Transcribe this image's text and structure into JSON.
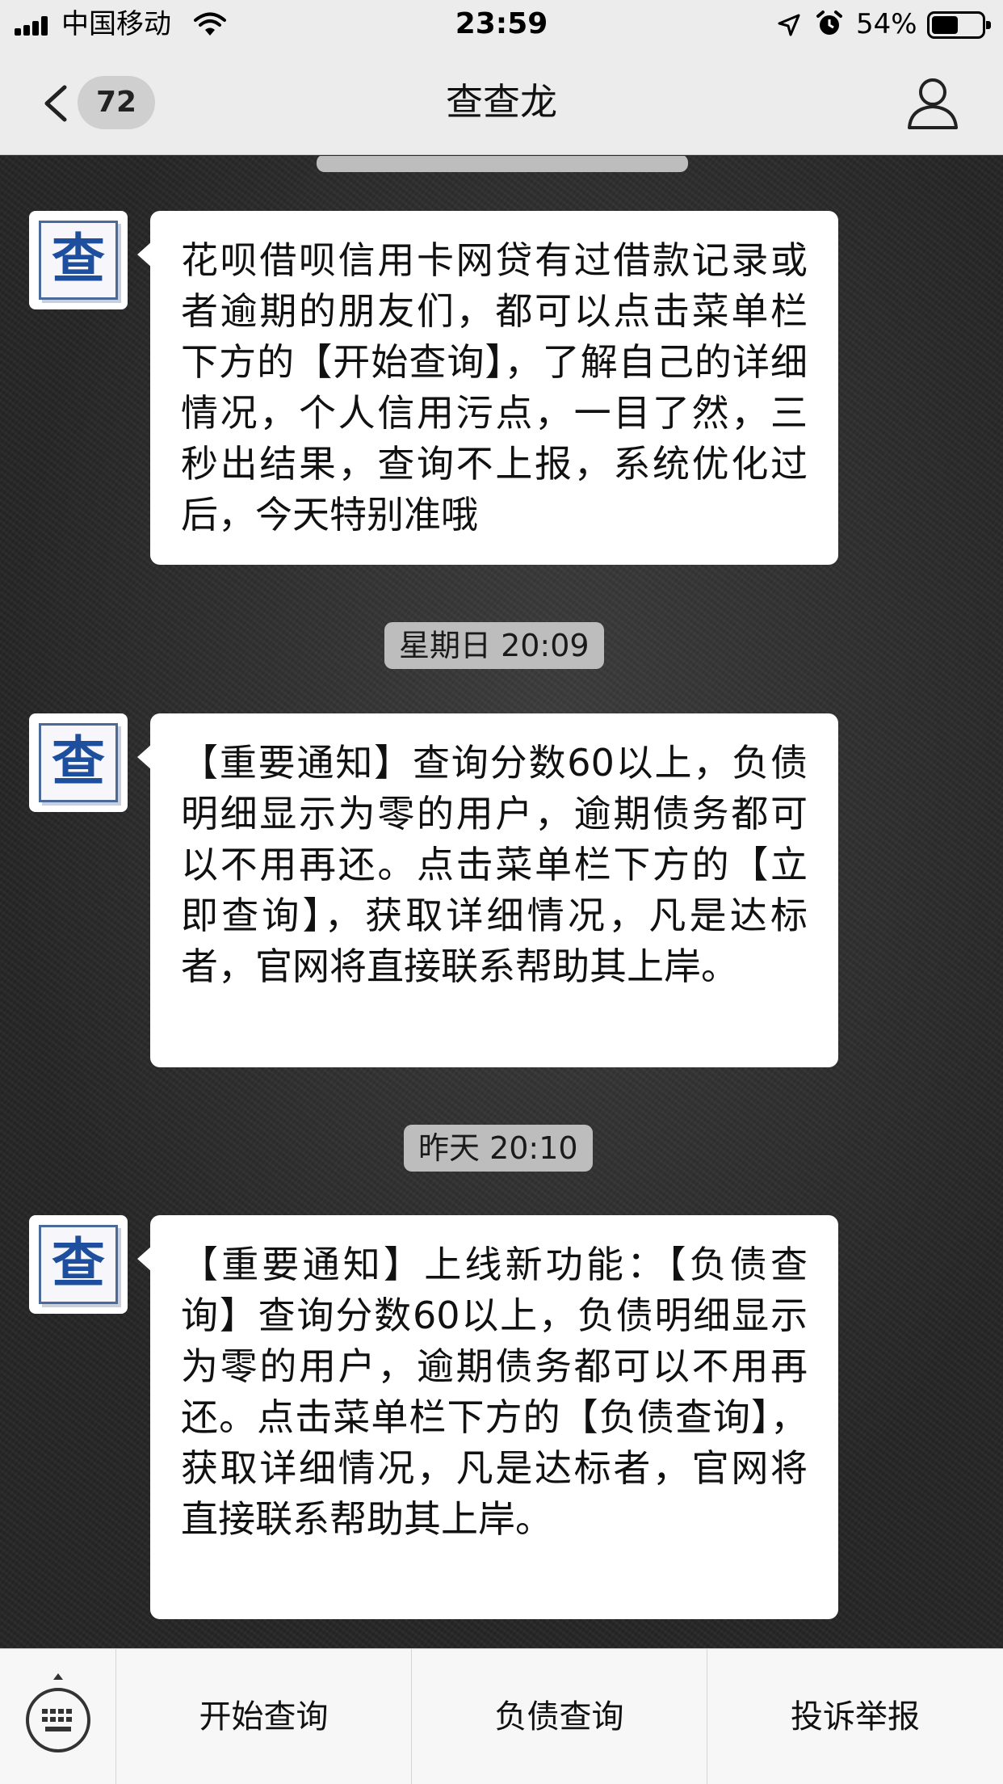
{
  "status_bar": {
    "carrier": "中国移动",
    "time": "23:59",
    "battery_percent_text": "54%",
    "battery_level": 0.54,
    "signal_bars": 4
  },
  "nav": {
    "back_badge": "72",
    "title": "查查龙"
  },
  "chat": {
    "avatar_glyph": "查",
    "messages": [
      {
        "text": "花呗借呗信用卡网贷有过借款记录或者逾期的朋友们，都可以点击菜单栏下方的【开始查询】，了解自己的详细情况，个人信用污点，一目了然，三秒出结果，查询不上报，系统优化过后，今天特别准哦"
      },
      {
        "time": "星期日 20:09",
        "text": "【重要通知】查询分数60以上，负债明细显示为零的用户，逾期债务都可以不用再还。点击菜单栏下方的【立即查询】，获取详细情况，凡是达标者，官网将直接联系帮助其上岸。"
      },
      {
        "time": "昨天 20:10",
        "text": "【重要通知】上线新功能：【负债查询】查询分数60以上，负债明细显示为零的用户，逾期债务都可以不用再还。点击菜单栏下方的【负债查询】，获取详细情况，凡是达标者，官网将直接联系帮助其上岸。"
      }
    ]
  },
  "menu": {
    "items": [
      "开始查询",
      "负债查询",
      "投诉举报"
    ]
  }
}
